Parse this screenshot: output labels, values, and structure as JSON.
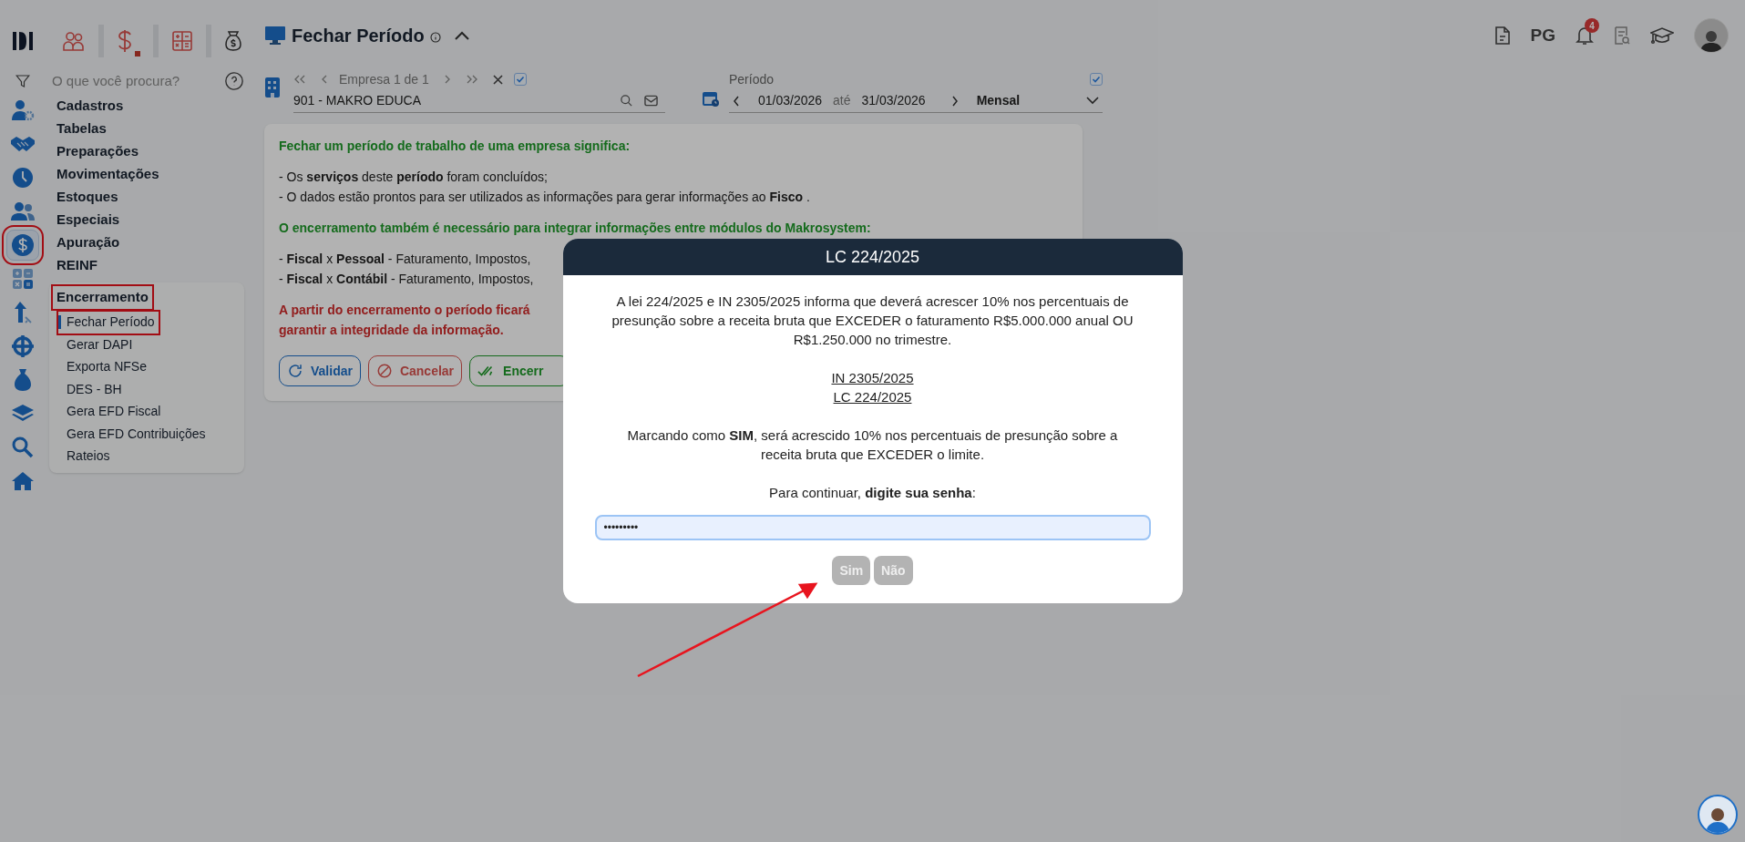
{
  "modules": [
    {
      "active": false
    },
    {
      "active": true
    },
    {
      "active": false
    },
    {
      "active": false
    }
  ],
  "search": {
    "placeholder": "O que você procura?"
  },
  "nav_rail": [
    {
      "selected": false,
      "highlighted": false
    },
    {
      "selected": false,
      "highlighted": false
    },
    {
      "selected": false,
      "highlighted": false
    },
    {
      "selected": false,
      "highlighted": false
    },
    {
      "selected": true,
      "highlighted": true
    },
    {
      "selected": false,
      "highlighted": false
    },
    {
      "selected": false,
      "highlighted": false
    },
    {
      "selected": false,
      "highlighted": false
    },
    {
      "selected": false,
      "highlighted": false
    },
    {
      "selected": false,
      "highlighted": false
    },
    {
      "selected": false,
      "highlighted": false
    },
    {
      "selected": false,
      "highlighted": false
    }
  ],
  "menu": [
    {
      "label": "Cadastros",
      "expanded": false,
      "highlighted": false
    },
    {
      "label": "Tabelas",
      "expanded": false,
      "highlighted": false
    },
    {
      "label": "Preparações",
      "expanded": false,
      "highlighted": false
    },
    {
      "label": "Movimentações",
      "expanded": false,
      "highlighted": false
    },
    {
      "label": "Estoques",
      "expanded": false,
      "highlighted": false
    },
    {
      "label": "Especiais",
      "expanded": false,
      "highlighted": false
    },
    {
      "label": "Apuração",
      "expanded": false,
      "highlighted": false
    },
    {
      "label": "REINF",
      "expanded": false,
      "highlighted": false
    },
    {
      "label": "Encerramento",
      "expanded": true,
      "highlighted": true,
      "children": [
        {
          "label": "Fechar Período",
          "selected": true,
          "highlighted": true
        },
        {
          "label": "Gerar DAPI",
          "selected": false,
          "highlighted": false
        },
        {
          "label": "Exporta NFSe",
          "selected": false,
          "highlighted": false
        },
        {
          "label": "DES - BH",
          "selected": false,
          "highlighted": false
        },
        {
          "label": "Gera EFD Fiscal",
          "selected": false,
          "highlighted": false
        },
        {
          "label": "Gera EFD Contribuições",
          "selected": false,
          "highlighted": false
        },
        {
          "label": "Rateios",
          "selected": false,
          "highlighted": false
        }
      ]
    }
  ],
  "page_title": "Fechar Período",
  "company": {
    "counter": "Empresa 1 de 1",
    "all_checked": true,
    "value": "901 - MAKRO EDUCA"
  },
  "period": {
    "label": "Período",
    "checked": true,
    "start": "01/03/2026",
    "separator": "até",
    "end": "31/03/2026",
    "frequency": "Mensal"
  },
  "user_menu": {
    "initials": "PG",
    "notifications": "4"
  },
  "info": [
    {
      "kind": "heading",
      "text": "Fechar um período de trabalho de uma empresa significa:"
    },
    {
      "kind": "line",
      "text": "- Os **serviços** deste **período** foram concluídos;"
    },
    {
      "kind": "line",
      "text": "- O dados estão prontos para ser utilizados as informações para gerar informações ao **Fisco** ."
    },
    {
      "kind": "heading",
      "text": "O encerramento também é necessário para integrar informações entre módulos do Makrosystem:"
    },
    {
      "kind": "line",
      "text": "- **Fiscal** x **Pessoal** - Faturamento, Impostos,"
    },
    {
      "kind": "line",
      "text": "- **Fiscal** x **Contábil** - Faturamento, Impostos,"
    },
    {
      "kind": "warning",
      "text": "A partir do encerramento o período ficará"
    },
    {
      "kind": "warning",
      "text": "garantir a integridade da informação."
    }
  ],
  "actions": [
    {
      "label": "Validar",
      "kind": "validate"
    },
    {
      "label": "Cancelar",
      "kind": "cancel"
    },
    {
      "label": "Encerr",
      "kind": "close"
    }
  ],
  "dialog": {
    "title": "LC 224/2025",
    "message": "A lei 224/2025 e IN 2305/2025 informa que deverá acrescer 10% nos percentuais de presunção sobre a receita bruta que EXCEDER o faturamento R$5.000.000 anual OU R$1.250.000 no trimestre.",
    "links": [
      "IN 2305/2025",
      "LC 224/2025"
    ],
    "note": "Marcando como **SIM**, será acrescido 10% nos percentuais de presunção sobre a receita bruta que EXCEDER o limite.",
    "prompt": "Para continuar, **digite sua senha**:",
    "password": "•••••••••",
    "buttons": [
      {
        "label": "Sim",
        "disabled": true
      },
      {
        "label": "Não",
        "disabled": true
      }
    ]
  }
}
